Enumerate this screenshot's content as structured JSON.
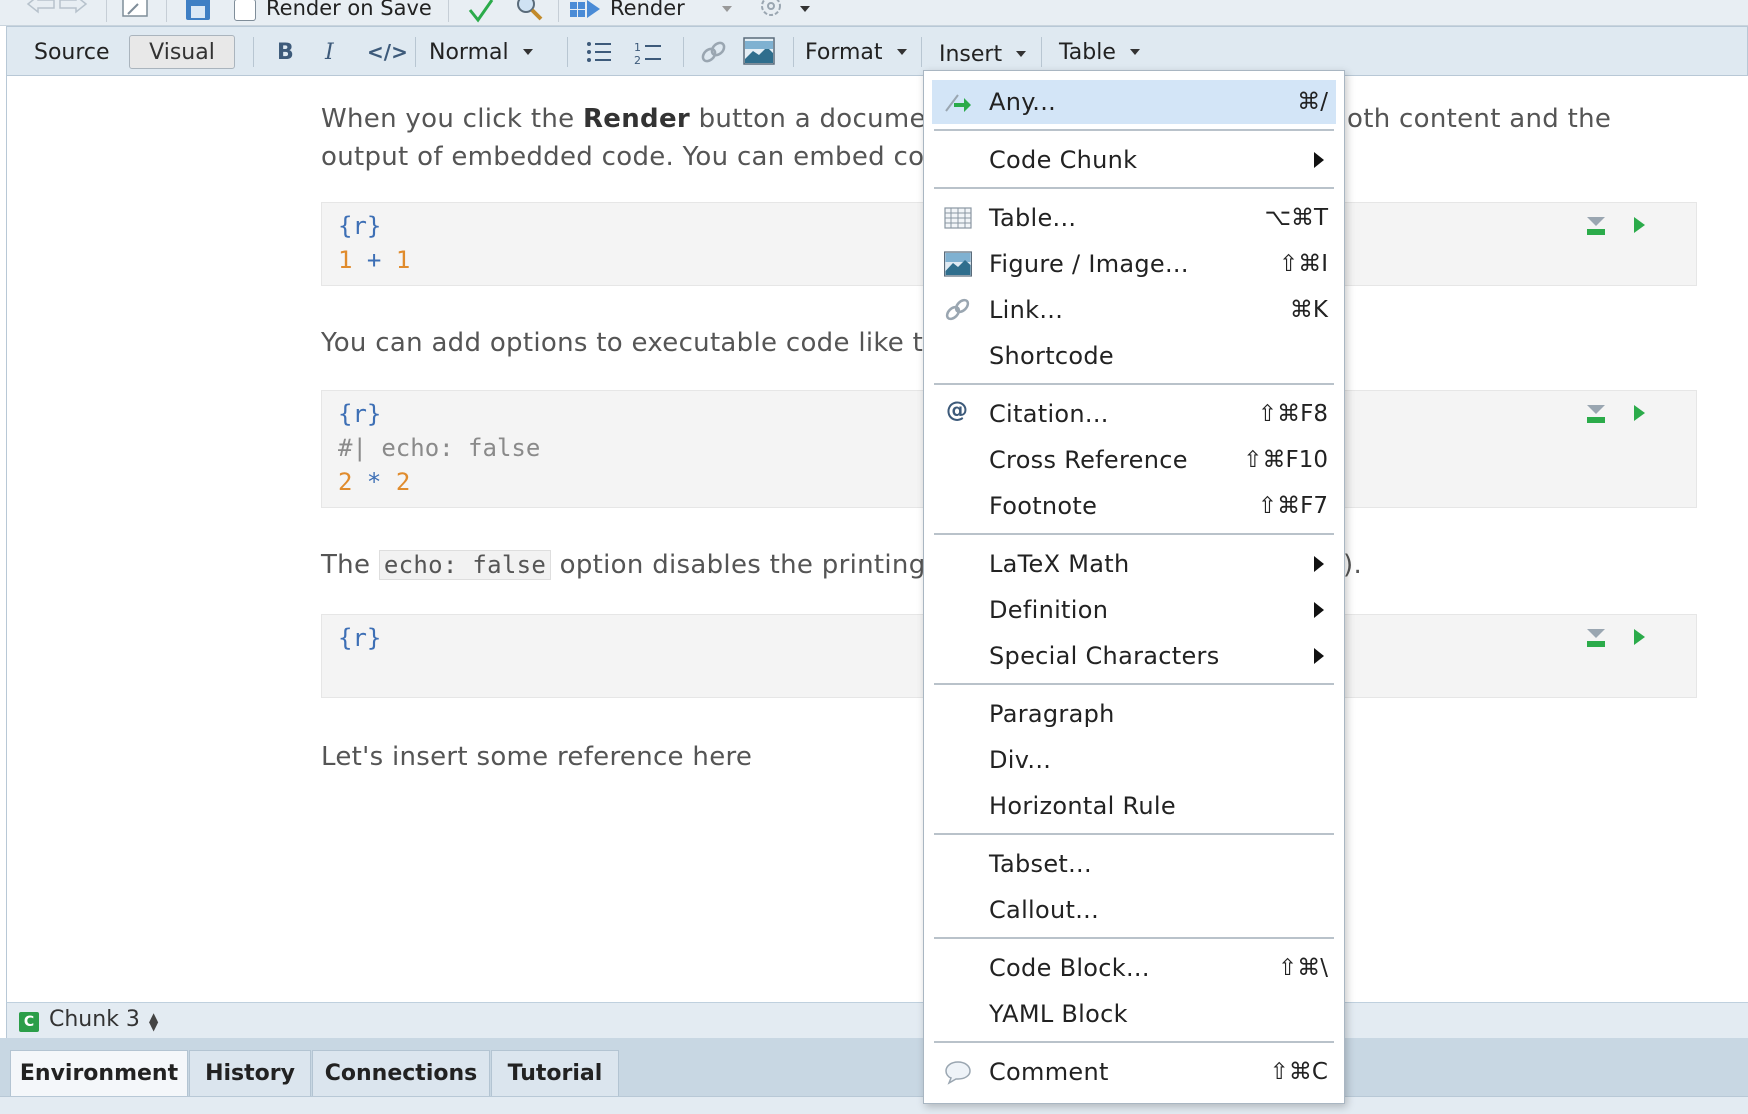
{
  "top_toolbar": {
    "render_on_save": "Render on Save",
    "render": "Render"
  },
  "format_toolbar": {
    "source": "Source",
    "visual": "Visual",
    "bold": "B",
    "italic": "I",
    "code": "</>",
    "style": "Normal",
    "format": "Format",
    "insert": "Insert",
    "table": "Table"
  },
  "editor": {
    "para1_a": "When you click the ",
    "para1_bold": "Render",
    "para1_b": " button a document",
    "para1_c": "oth content and the",
    "para1_line2": "output of embedded code. You can embed coc",
    "chunk1": {
      "header": "{r}",
      "n1": "1",
      "op": "+",
      "n2": "1"
    },
    "para2": "You can add options to executable code like th",
    "chunk2": {
      "header": "{r}",
      "option": "#| echo: false",
      "n1": "2",
      "op": "*",
      "n2": "2"
    },
    "para3_a": "The ",
    "para3_code": "echo: false",
    "para3_b": " option disables the printing c",
    "para3_c": ").",
    "chunk3": {
      "header": "{r}"
    },
    "para4": "Let's insert some reference here"
  },
  "status_bar": {
    "badge": "C",
    "chunk": "Chunk 3"
  },
  "pane_tabs": [
    "Environment",
    "History",
    "Connections",
    "Tutorial"
  ],
  "insert_menu": {
    "any": {
      "label": "Any...",
      "shortcut": "⌘/"
    },
    "code_chunk": "Code Chunk",
    "table": {
      "label": "Table...",
      "shortcut": "⌥⌘T"
    },
    "figure": {
      "label": "Figure / Image...",
      "shortcut": "⇧⌘I"
    },
    "link": {
      "label": "Link...",
      "shortcut": "⌘K"
    },
    "shortcode": "Shortcode",
    "citation": {
      "label": "Citation...",
      "shortcut": "⇧⌘F8"
    },
    "cross_reference": {
      "label": "Cross Reference",
      "shortcut": "⇧⌘F10"
    },
    "footnote": {
      "label": "Footnote",
      "shortcut": "⇧⌘F7"
    },
    "latex_math": "LaTeX Math",
    "definition": "Definition",
    "special_characters": "Special Characters",
    "paragraph": "Paragraph",
    "div": "Div...",
    "horizontal_rule": "Horizontal Rule",
    "tabset": "Tabset...",
    "callout": "Callout...",
    "code_block": {
      "label": "Code Block...",
      "shortcut": "⇧⌘\\"
    },
    "yaml_block": "YAML Block",
    "comment": {
      "label": "Comment",
      "shortcut": "⇧⌘C"
    }
  },
  "colors": {
    "accent_green": "#2bab4a",
    "menu_highlight": "#d3e5f7",
    "code_blue": "#3d6fb5",
    "code_orange": "#e08b2c"
  }
}
